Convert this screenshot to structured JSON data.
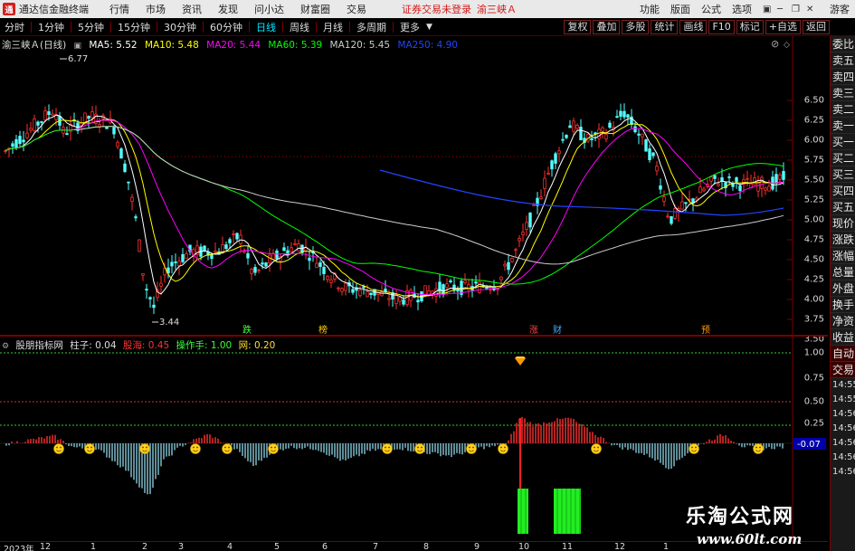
{
  "app": {
    "name": "通达信金融终端",
    "status": "证券交易未登录",
    "stock": "渝三峡Ａ"
  },
  "menu": [
    "行情",
    "市场",
    "资讯",
    "发现",
    "问小达",
    "财富圈",
    "交易"
  ],
  "menu_right": [
    "功能",
    "版面",
    "公式",
    "选项",
    "游客"
  ],
  "periods": [
    "分时",
    "1分钟",
    "5分钟",
    "15分钟",
    "30分钟",
    "60分钟",
    "日线",
    "周线",
    "月线",
    "多周期",
    "更多"
  ],
  "toolbar_right": [
    "复权",
    "叠加",
    "多股",
    "统计",
    "画线",
    "F10",
    "标记",
    "+自选",
    "返回"
  ],
  "ma_line": {
    "title": "渝三峡Ａ(日线)",
    "ma5": "MA5: 5.52",
    "ma10": "MA10: 5.48",
    "ma20": "MA20: 5.44",
    "ma60": "MA60: 5.39",
    "ma120": "MA120: 5.45",
    "ma250": "MA250: 4.90"
  },
  "price_labels": {
    "high": "6.77",
    "low": "3.44"
  },
  "price_axis": [
    "6.50",
    "6.25",
    "6.00",
    "5.75",
    "5.50",
    "5.25",
    "5.00",
    "4.75",
    "4.50",
    "4.25",
    "4.00",
    "3.75",
    "3.50"
  ],
  "markers": {
    "die": "跌",
    "bang": "榜",
    "zhang": "涨",
    "cai": "财",
    "yu": "预"
  },
  "indicator": {
    "name": "股朋指标网",
    "zhuzi": "柱子: 0.04",
    "baohai": "股海: 0.45",
    "caozuo": "操作手: 1.00",
    "wang": "网: 0.20",
    "current": "-0.07"
  },
  "sub_axis": [
    "1.00",
    "0.75",
    "0.50",
    "0.25"
  ],
  "side_panel": [
    "委比",
    "卖五",
    "卖四",
    "卖三",
    "卖二",
    "卖一",
    "买一",
    "买二",
    "买三",
    "买四",
    "买五",
    "现价",
    "涨跌",
    "涨幅",
    "总量",
    "外盘",
    "换手",
    "净资",
    "收益",
    "自动",
    "交易"
  ],
  "side_times": [
    "14:55",
    "14:55",
    "14:56",
    "14:56",
    "14:56",
    "14:56",
    "14:56"
  ],
  "x_axis": [
    "2023年",
    "12",
    "1",
    "2",
    "3",
    "4",
    "5",
    "6",
    "7",
    "8",
    "9",
    "10",
    "11",
    "12",
    "1"
  ],
  "watermark": {
    "title": "乐淘公式网",
    "url": "www.60lt.com"
  },
  "colors": {
    "ma5": "#ffffff",
    "ma10": "#ffff00",
    "ma20": "#ff00ff",
    "ma60": "#00ff00",
    "ma120": "#cccccc",
    "ma250": "#2244ff",
    "up": "#ff3030",
    "down": "#54ffff",
    "grid": "#7a0000"
  }
}
